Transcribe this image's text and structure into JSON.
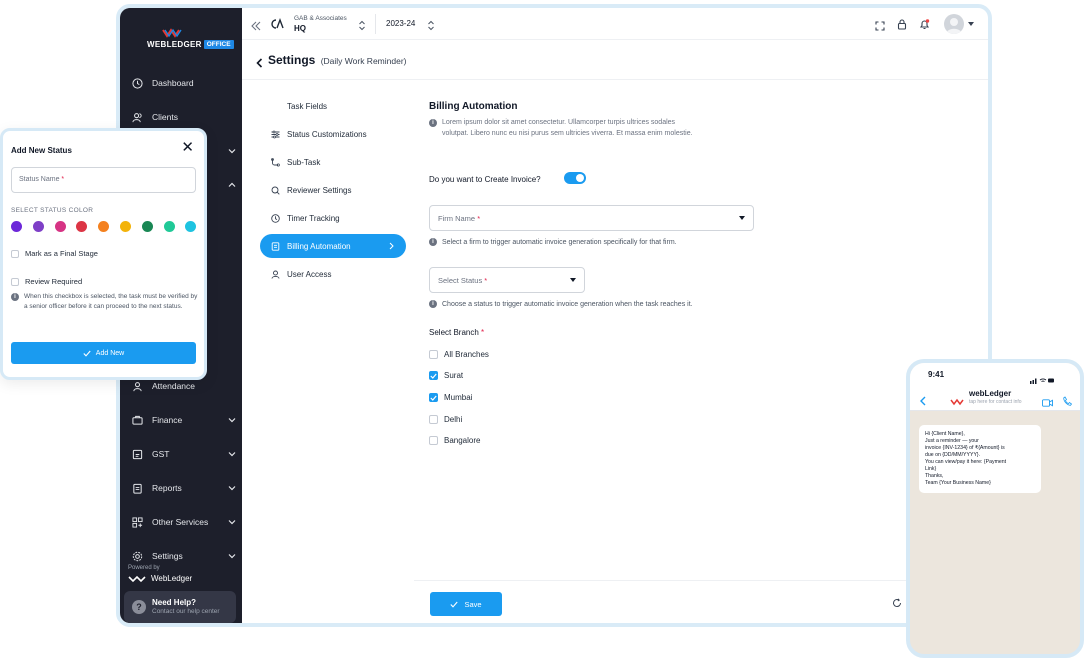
{
  "brand": {
    "logo_text": "WEBLEDGER",
    "logo_badge": "OFFICE",
    "powered_by": "Powered by",
    "powered_name": "WebLedger"
  },
  "sidebar": {
    "items": [
      {
        "label": "Dashboard"
      },
      {
        "label": "Clients"
      },
      {
        "label": "Attendance"
      },
      {
        "label": "Finance"
      },
      {
        "label": "GST"
      },
      {
        "label": "Reports"
      },
      {
        "label": "Other Services"
      },
      {
        "label": "Settings"
      }
    ],
    "help": {
      "title": "Need Help?",
      "subtitle": "Contact our help center"
    }
  },
  "topbar": {
    "org_name": "GAB & Associates",
    "branch": "HQ",
    "year": "2023-24"
  },
  "page": {
    "title": "Settings",
    "subtitle": "(Daily Work Reminder)"
  },
  "settings_menu": [
    {
      "label": "Task Fields"
    },
    {
      "label": "Status Customizations"
    },
    {
      "label": "Sub-Task"
    },
    {
      "label": "Reviewer Settings"
    },
    {
      "label": "Timer Tracking"
    },
    {
      "label": "Billing Automation"
    },
    {
      "label": "User Access"
    }
  ],
  "billing": {
    "title": "Billing Automation",
    "description_line1": "Lorem ipsum dolor sit amet consectetur. Ullamcorper turpis ultrices sodales",
    "description_line2": "volutpat. Libero nunc eu nisi purus sem ultricies viverra. Et massa enim molestie.",
    "invoice_question": "Do you want to Create Invoice?",
    "invoice_toggle_on": true,
    "firm_placeholder": "Firm Name",
    "firm_hint": "Select a firm to trigger automatic invoice generation specifically for that firm.",
    "status_placeholder": "Select Status",
    "status_hint": "Choose a status to trigger automatic invoice generation when the task reaches it.",
    "branch_label": "Select Branch",
    "required_mark": "*",
    "branches": [
      {
        "label": "All Branches",
        "checked": false
      },
      {
        "label": "Surat",
        "checked": true
      },
      {
        "label": "Mumbai",
        "checked": true
      },
      {
        "label": "Delhi",
        "checked": false
      },
      {
        "label": "Bangalore",
        "checked": false
      }
    ],
    "save_label": "Save",
    "reset_label": "R"
  },
  "modal": {
    "title": "Add New Status",
    "status_name_placeholder": "Status Name",
    "color_label": "SELECT STATUS COLOR",
    "colors": [
      "#6d28d9",
      "#7e3fc7",
      "#d63384",
      "#dc3545",
      "#f4811f",
      "#f3b30a",
      "#198754",
      "#20c997",
      "#1ec3e0"
    ],
    "final_stage_label": "Mark as a Final Stage",
    "review_label": "Review Required",
    "review_note": "When this checkbox is selected, the task must be verified by a senior officer before it can proceed to the next status.",
    "add_button": "Add New"
  },
  "phone": {
    "time": "9:41",
    "contact_name": "webLedger",
    "contact_tap": "tap here for contact info",
    "message": "Hi {Client Name},\nJust a reminder — your\ninvoice {INV-1234} of ₹{Amount} is\ndue on {DD/MM/YYYY}.\nYou can view/pay it here: {Payment\nLink}\nThanks,\nTeam {Your Business Name}"
  }
}
